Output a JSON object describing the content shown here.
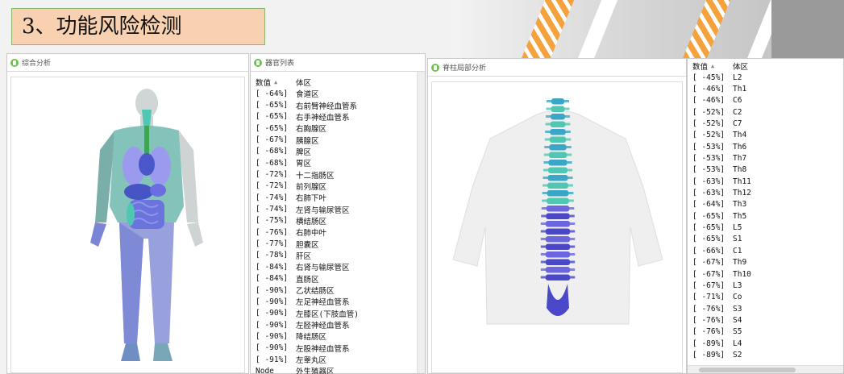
{
  "title": "3、功能风险检测",
  "panels": {
    "overview": {
      "label": "综合分析"
    },
    "organs": {
      "label": "器官列表"
    },
    "spine": {
      "label": "脊柱局部分析"
    }
  },
  "organ_list": {
    "col_value": "数值",
    "col_region": "体区",
    "rows": [
      {
        "v": "[ -64%]",
        "r": "食道区"
      },
      {
        "v": "[ -65%]",
        "r": "右前臂神经血管系"
      },
      {
        "v": "[ -65%]",
        "r": "右手神经血管系"
      },
      {
        "v": "[ -65%]",
        "r": "右胸腺区"
      },
      {
        "v": "[ -67%]",
        "r": "胰腺区"
      },
      {
        "v": "[ -68%]",
        "r": "脾区"
      },
      {
        "v": "[ -68%]",
        "r": "胃区"
      },
      {
        "v": "[ -72%]",
        "r": "十二指肠区"
      },
      {
        "v": "[ -72%]",
        "r": "前列腺区"
      },
      {
        "v": "[ -74%]",
        "r": "右肺下叶"
      },
      {
        "v": "[ -74%]",
        "r": "左肾与输尿管区"
      },
      {
        "v": "[ -75%]",
        "r": "横结肠区"
      },
      {
        "v": "[ -76%]",
        "r": "右肺中叶"
      },
      {
        "v": "[ -77%]",
        "r": "胆囊区"
      },
      {
        "v": "[ -78%]",
        "r": "肝区"
      },
      {
        "v": "[ -84%]",
        "r": "右肾与输尿管区"
      },
      {
        "v": "[ -84%]",
        "r": "直肠区"
      },
      {
        "v": "[ -90%]",
        "r": "乙状结肠区"
      },
      {
        "v": "[ -90%]",
        "r": "左足神经血管系"
      },
      {
        "v": "[ -90%]",
        "r": "左膝区(下肢血管)"
      },
      {
        "v": "[ -90%]",
        "r": "左胫神经血管系"
      },
      {
        "v": "[ -90%]",
        "r": "降结肠区"
      },
      {
        "v": "[ -90%]",
        "r": "左股神经血管系"
      },
      {
        "v": "[ -91%]",
        "r": "左睾丸区"
      },
      {
        "v": "Node",
        "r": "外生殖器区"
      }
    ]
  },
  "spine_list": {
    "col_value": "数值",
    "col_region": "体区",
    "rows": [
      {
        "v": "[ -45%]",
        "r": "L2"
      },
      {
        "v": "[ -46%]",
        "r": "Th1"
      },
      {
        "v": "[ -46%]",
        "r": "C6"
      },
      {
        "v": "[ -52%]",
        "r": "C2"
      },
      {
        "v": "[ -52%]",
        "r": "C7"
      },
      {
        "v": "[ -52%]",
        "r": "Th4"
      },
      {
        "v": "[ -53%]",
        "r": "Th6"
      },
      {
        "v": "[ -53%]",
        "r": "Th7"
      },
      {
        "v": "[ -53%]",
        "r": "Th8"
      },
      {
        "v": "[ -63%]",
        "r": "Th11"
      },
      {
        "v": "[ -63%]",
        "r": "Th12"
      },
      {
        "v": "[ -64%]",
        "r": "Th3"
      },
      {
        "v": "[ -65%]",
        "r": "Th5"
      },
      {
        "v": "[ -65%]",
        "r": "L5"
      },
      {
        "v": "[ -65%]",
        "r": "S1"
      },
      {
        "v": "[ -66%]",
        "r": "C1"
      },
      {
        "v": "[ -67%]",
        "r": "Th9"
      },
      {
        "v": "[ -67%]",
        "r": "Th10"
      },
      {
        "v": "[ -67%]",
        "r": "L3"
      },
      {
        "v": "[ -71%]",
        "r": "Co"
      },
      {
        "v": "[ -76%]",
        "r": "S3"
      },
      {
        "v": "[ -76%]",
        "r": "S4"
      },
      {
        "v": "[ -76%]",
        "r": "S5"
      },
      {
        "v": "[ -89%]",
        "r": "L4"
      },
      {
        "v": "[ -89%]",
        "r": "S2"
      }
    ]
  },
  "icons": {
    "panel_head": "app-icon",
    "sort": "sort-up-icon"
  },
  "colors": {
    "accent_teal": "#4fc7b3",
    "accent_blue": "#5b57d6",
    "title_bg": "#f8d1b0",
    "stripe_orange": "#f5a23c"
  }
}
